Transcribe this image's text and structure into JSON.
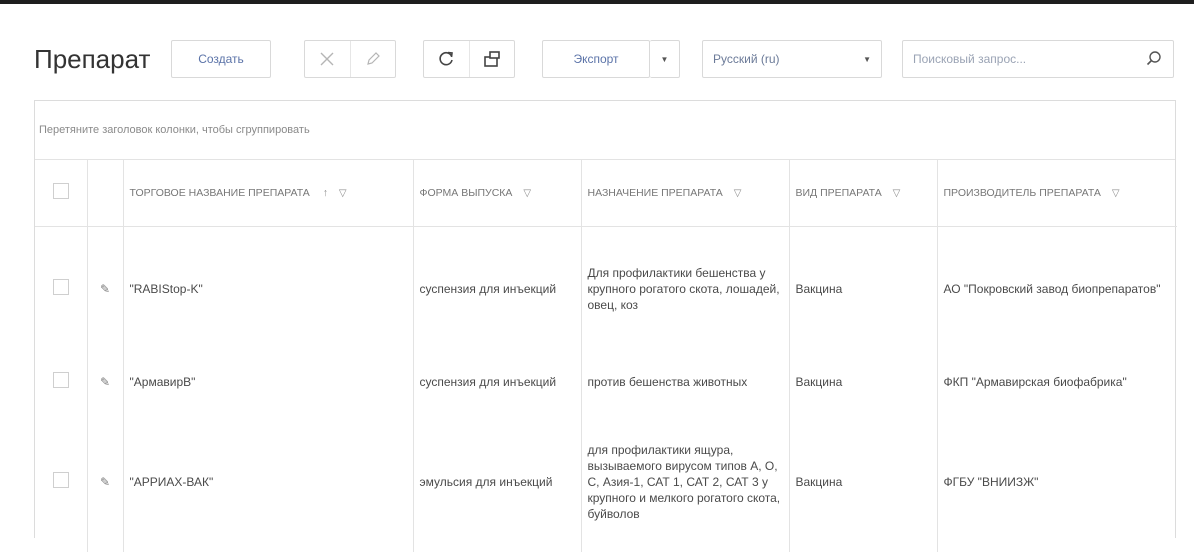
{
  "page": {
    "title": "Препарат"
  },
  "toolbar": {
    "create_label": "Создать",
    "export_label": "Экспорт",
    "language_value": "Русский (ru)",
    "search_placeholder": "Поисковый запрос..."
  },
  "grid": {
    "group_hint": "Перетяните заголовок колонки, чтобы сгруппировать",
    "columns": [
      "ТОРГОВОЕ НАЗВАНИЕ ПРЕПАРАТА",
      "ФОРМА ВЫПУСКА",
      "НАЗНАЧЕНИЕ ПРЕПАРАТА",
      "ВИД ПРЕПАРАТА",
      "ПРОИЗВОДИТЕЛЬ ПРЕПАРАТА"
    ],
    "rows": [
      {
        "name": "\"RABIStop-K\"",
        "form": "суспензия для инъекций",
        "purpose": "Для профилактики бешенства у крупного рогатого скота, лошадей, овец, коз",
        "type": "Вакцина",
        "manufacturer": "АО \"Покровский завод биопрепаратов\""
      },
      {
        "name": "\"АрмавирВ\"",
        "form": "суспензия для инъекций",
        "purpose": "против бешенства животных",
        "type": "Вакцина",
        "manufacturer": "ФКП \"Армавирская биофабрика\""
      },
      {
        "name": "\"АРРИАХ-ВАК\"",
        "form": "эмульсия для инъекций",
        "purpose": "для профилактики ящура, вызываемого вирусом типов А, О, С, Азия-1, САТ 1, САТ 2, САТ 3 у крупного и мелкого рогатого скота, буйволов",
        "type": "Вакцина",
        "manufacturer": "ФГБУ \"ВНИИЗЖ\""
      }
    ]
  },
  "colors": {
    "accent": "#5b73a8",
    "border": "#dcdcdc"
  }
}
